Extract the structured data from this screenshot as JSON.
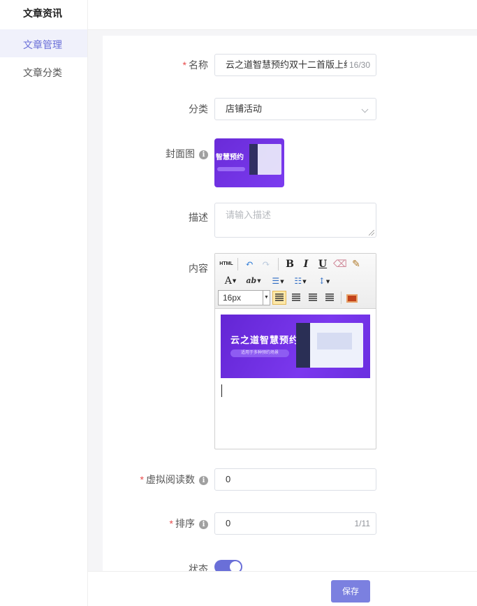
{
  "sidebar": {
    "title": "文章资讯",
    "items": [
      {
        "label": "文章管理",
        "active": true
      },
      {
        "label": "文章分类",
        "active": false
      }
    ]
  },
  "form": {
    "required_mark": "*",
    "name": {
      "label": "名称",
      "required": true,
      "value": "云之道智慧预约双十二首版上线",
      "counter": "16/30"
    },
    "category": {
      "label": "分类",
      "value": "店铺活动"
    },
    "cover": {
      "label": "封面图",
      "has_info": true,
      "image_text": "智慧预约"
    },
    "description": {
      "label": "描述",
      "placeholder": "请输入描述",
      "value": ""
    },
    "content": {
      "label": "内容",
      "toolbar": {
        "html_label": "HTML",
        "font_size": "16px",
        "bold": "B",
        "italic": "I",
        "underline": "U",
        "font_color": "A"
      },
      "banner": {
        "title": "云之道智慧预约",
        "subtitle": "适用于多种预约场景"
      }
    },
    "virtual_reads": {
      "label": "虚拟阅读数",
      "required": true,
      "has_info": true,
      "value": "0"
    },
    "sort": {
      "label": "排序",
      "required": true,
      "has_info": true,
      "value": "0",
      "counter": "1/11"
    },
    "status": {
      "label": "状态",
      "enabled": true
    }
  },
  "footer": {
    "save_label": "保存"
  },
  "colors": {
    "accent": "#6a6fd8",
    "required": "#e84a4a",
    "banner": "#7b38ee"
  }
}
